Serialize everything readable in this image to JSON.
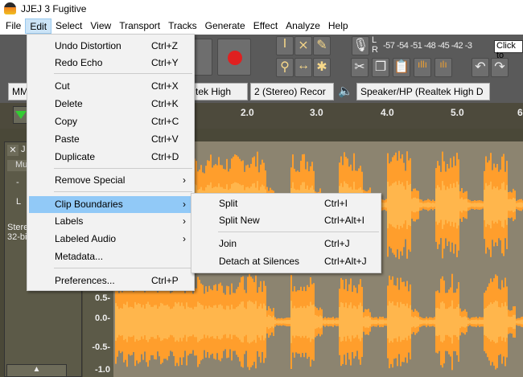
{
  "window": {
    "title": "JJEJ 3 Fugitive"
  },
  "menubar": [
    "File",
    "Edit",
    "Select",
    "View",
    "Transport",
    "Tracks",
    "Generate",
    "Effect",
    "Analyze",
    "Help"
  ],
  "edit_menu": [
    {
      "label": "Undo Distortion",
      "shortcut": "Ctrl+Z"
    },
    {
      "label": "Redo Echo",
      "shortcut": "Ctrl+Y"
    },
    {
      "label": "Cut",
      "shortcut": "Ctrl+X"
    },
    {
      "label": "Delete",
      "shortcut": "Ctrl+K"
    },
    {
      "label": "Copy",
      "shortcut": "Ctrl+C"
    },
    {
      "label": "Paste",
      "shortcut": "Ctrl+V"
    },
    {
      "label": "Duplicate",
      "shortcut": "Ctrl+D"
    },
    {
      "label": "Remove Special",
      "shortcut": ""
    },
    {
      "label": "Clip Boundaries",
      "shortcut": ""
    },
    {
      "label": "Labels",
      "shortcut": ""
    },
    {
      "label": "Labeled Audio",
      "shortcut": ""
    },
    {
      "label": "Metadata...",
      "shortcut": ""
    },
    {
      "label": "Preferences...",
      "shortcut": "Ctrl+P"
    }
  ],
  "submenu": [
    {
      "label": "Split",
      "shortcut": "Ctrl+I"
    },
    {
      "label": "Split New",
      "shortcut": "Ctrl+Alt+I"
    },
    {
      "label": "Join",
      "shortcut": "Ctrl+J"
    },
    {
      "label": "Detach at Silences",
      "shortcut": "Ctrl+Alt+J"
    }
  ],
  "meter": {
    "L": "L",
    "R": "R",
    "scale": "-57 -54 -51 -48 -45 -42 -3",
    "tooltip": "Click to"
  },
  "devices": {
    "host": "MM",
    "rec_device": "tek High",
    "channels": "2 (Stereo) Recor",
    "playback": "Speaker/HP (Realtek High D"
  },
  "timeline": [
    "2.0",
    "3.0",
    "4.0",
    "5.0",
    "6"
  ],
  "track": {
    "name": "J",
    "mute": "Mut",
    "gain": "-",
    "pan": "L",
    "info1": "Stere",
    "info2": "32-bi"
  },
  "vruler": [
    "0.5-",
    "0.0-",
    "-0.5-",
    "-1.0"
  ],
  "colors": {
    "wave": "#ff9e2c",
    "wave_rms": "#ffb64c",
    "highlight": "#91c9f7"
  }
}
